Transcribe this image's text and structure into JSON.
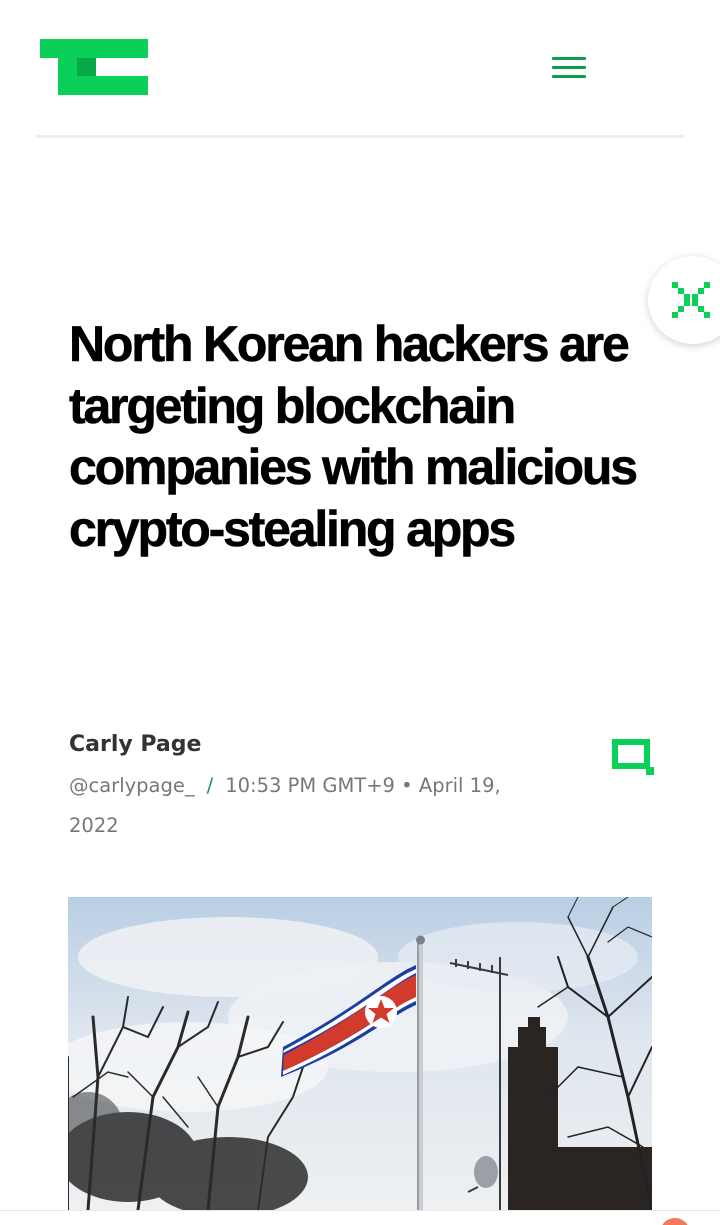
{
  "brand": {
    "logo_icon": "techcrunch-tc-logo",
    "accent_color": "#0a9e4e",
    "logo_color": "#0acf59"
  },
  "header": {
    "menu_icon": "hamburger-menu-icon"
  },
  "overlay": {
    "close_icon": "close-x-icon"
  },
  "article": {
    "headline": "North Korean hackers are targeting blockchain companies with malicious crypto-stealing apps",
    "author": "Carly Page",
    "handle": "@carlypage_",
    "separator": "/",
    "time": "10:53 PM GMT+9",
    "bullet": "•",
    "date_part1": "April 19,",
    "date_part2": "2022",
    "comment_icon": "comment-bubble-icon",
    "hero_image": "north-korean-flag-on-flagpole-with-trees-and-antenna"
  }
}
